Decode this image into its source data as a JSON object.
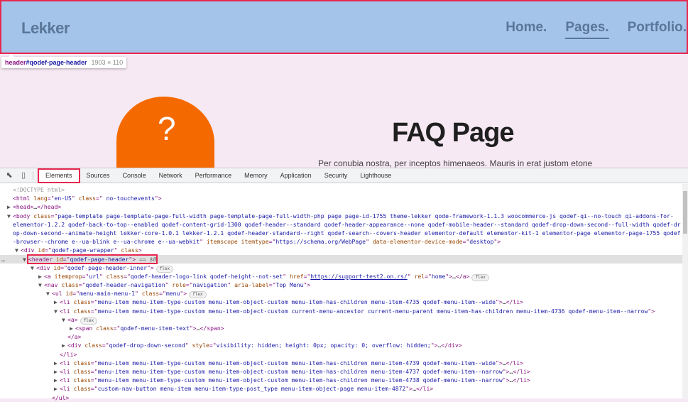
{
  "site": {
    "logo": "Lekker",
    "nav": [
      {
        "label": "Home.",
        "active": false
      },
      {
        "label": "Pages.",
        "active": true
      },
      {
        "label": "Portfolio.",
        "active": false
      }
    ],
    "faq_icon": "?",
    "title": "FAQ Page",
    "subtitle": "Per conubia nostra, per inceptos himenaeos. Mauris in erat justom etone"
  },
  "tooltip": {
    "tag": "header",
    "id": "#qodef-page-header",
    "size": "1903 × 110"
  },
  "devtools": {
    "icons": [
      "inspect-element-icon",
      "device-toggle-icon"
    ],
    "tabs": [
      "Elements",
      "Sources",
      "Console",
      "Network",
      "Performance",
      "Memory",
      "Application",
      "Security",
      "Lighthouse"
    ],
    "selected_tab": "Elements",
    "lines": [
      {
        "i": 0,
        "a": "",
        "t": [
          [
            "cm",
            "<!DOCTYPE html>"
          ]
        ]
      },
      {
        "i": 0,
        "a": "",
        "t": [
          [
            "tag",
            "<html "
          ],
          [
            "an",
            "lang"
          ],
          [
            "tag",
            "=\""
          ],
          [
            "av",
            "en-US"
          ],
          [
            "tag",
            "\" "
          ],
          [
            "an",
            "class"
          ],
          [
            "tag",
            "=\""
          ],
          [
            "av",
            " no-touchevents"
          ],
          [
            "tag",
            "\">"
          ]
        ]
      },
      {
        "i": 0,
        "a": "▶",
        "t": [
          [
            "tag",
            "<head>"
          ],
          [
            "tx",
            "…"
          ],
          [
            "tag",
            "</head>"
          ]
        ]
      },
      {
        "i": 0,
        "a": "▼",
        "t": [
          [
            "tag",
            "<body "
          ],
          [
            "an",
            "class"
          ],
          [
            "tag",
            "=\""
          ],
          [
            "av",
            "page-template page-template-page-full-width page-template-page-full-width-php page page-id-1755 theme-lekker qode-framework-1.1.3 woocommerce-js qodef-qi--no-touch qi-addons-for-"
          ]
        ]
      },
      {
        "i": 0,
        "a": "",
        "t": [
          [
            "av",
            "elementor-1.2.2 qodef-back-to-top--enabled qodef-content-grid-1300 qodef-header--standard qodef-header-appearance--none qodef-mobile-header--standard qodef-drop-down-second--full-width qodef-dr"
          ]
        ]
      },
      {
        "i": 0,
        "a": "",
        "t": [
          [
            "av",
            "op-down-second--animate-height lekker-core-1.0.1 lekker-1.2.1 qodef-header-standard--right qodef-search--covers-header elementor-default elementor-kit-1 elementor-page elementor-page-1755 qodef"
          ]
        ]
      },
      {
        "i": 0,
        "a": "",
        "t": [
          [
            "av",
            "-browser--chrome e--ua-blink e--ua-chrome e--ua-webkit"
          ],
          [
            "tag",
            "\" "
          ],
          [
            "an",
            "itemscope itemtype"
          ],
          [
            "tag",
            "=\""
          ],
          [
            "av",
            "https://schema.org/WebPage"
          ],
          [
            "tag",
            "\" "
          ],
          [
            "an",
            "data-elementor-device-mode"
          ],
          [
            "tag",
            "=\""
          ],
          [
            "av",
            "desktop"
          ],
          [
            "tag",
            "\">"
          ]
        ]
      },
      {
        "i": 1,
        "a": "▼",
        "t": [
          [
            "tag",
            "<div "
          ],
          [
            "an",
            "id"
          ],
          [
            "tag",
            "=\""
          ],
          [
            "av",
            "qodef-page-wrapper"
          ],
          [
            "tag",
            "\" "
          ],
          [
            "an",
            "class"
          ],
          [
            "tag",
            ">"
          ]
        ]
      },
      {
        "i": 2,
        "a": "▼",
        "sel": true,
        "t": [
          [
            "tag",
            "<header "
          ],
          [
            "an",
            "id"
          ],
          [
            "tag",
            "=\""
          ],
          [
            "av",
            "qodef-page-header"
          ],
          [
            "tag",
            "\">"
          ],
          [
            "sv",
            " == $0"
          ]
        ]
      },
      {
        "i": 3,
        "a": "▼",
        "t": [
          [
            "tag",
            "<div "
          ],
          [
            "an",
            "id"
          ],
          [
            "tag",
            "=\""
          ],
          [
            "av",
            "qodef-page-header-inner"
          ],
          [
            "tag",
            "\">"
          ]
        ],
        "badge": "flex"
      },
      {
        "i": 4,
        "a": "▶",
        "t": [
          [
            "tag",
            "<a "
          ],
          [
            "an",
            "itemprop"
          ],
          [
            "tag",
            "=\""
          ],
          [
            "av",
            "url"
          ],
          [
            "tag",
            "\" "
          ],
          [
            "an",
            "class"
          ],
          [
            "tag",
            "=\""
          ],
          [
            "av",
            "qodef-header-logo-link qodef-height--not-set"
          ],
          [
            "tag",
            "\" "
          ],
          [
            "an",
            "href"
          ],
          [
            "tag",
            "=\""
          ],
          [
            "lk",
            "https://support-test2.on.rs/"
          ],
          [
            "tag",
            "\" "
          ],
          [
            "an",
            "rel"
          ],
          [
            "tag",
            "=\""
          ],
          [
            "av",
            "home"
          ],
          [
            "tag",
            "\">"
          ],
          [
            "tx",
            "…"
          ],
          [
            "tag",
            "</a>"
          ]
        ],
        "badge": "flex"
      },
      {
        "i": 4,
        "a": "▼",
        "t": [
          [
            "tag",
            "<nav "
          ],
          [
            "an",
            "class"
          ],
          [
            "tag",
            "=\""
          ],
          [
            "av",
            "qodef-header-navigation"
          ],
          [
            "tag",
            "\" "
          ],
          [
            "an",
            "role"
          ],
          [
            "tag",
            "=\""
          ],
          [
            "av",
            "navigation"
          ],
          [
            "tag",
            "\" "
          ],
          [
            "an",
            "aria-label"
          ],
          [
            "tag",
            "=\""
          ],
          [
            "av",
            "Top Menu"
          ],
          [
            "tag",
            "\">"
          ]
        ]
      },
      {
        "i": 5,
        "a": "▼",
        "t": [
          [
            "tag",
            "<ul "
          ],
          [
            "an",
            "id"
          ],
          [
            "tag",
            "=\""
          ],
          [
            "av",
            "menu-main-menu-1"
          ],
          [
            "tag",
            "\" "
          ],
          [
            "an",
            "class"
          ],
          [
            "tag",
            "=\""
          ],
          [
            "av",
            "menu"
          ],
          [
            "tag",
            "\">"
          ]
        ],
        "badge": "flex"
      },
      {
        "i": 6,
        "a": "▶",
        "t": [
          [
            "tag",
            "<li "
          ],
          [
            "an",
            "class"
          ],
          [
            "tag",
            "=\""
          ],
          [
            "av",
            "menu-item menu-item-type-custom menu-item-object-custom menu-item-has-children menu-item-4735 qodef-menu-item--wide"
          ],
          [
            "tag",
            "\">"
          ],
          [
            "tx",
            "…"
          ],
          [
            "tag",
            "</li>"
          ]
        ]
      },
      {
        "i": 6,
        "a": "▼",
        "t": [
          [
            "tag",
            "<li "
          ],
          [
            "an",
            "class"
          ],
          [
            "tag",
            "=\""
          ],
          [
            "av",
            "menu-item menu-item-type-custom menu-item-object-custom current-menu-ancestor current-menu-parent menu-item-has-children menu-item-4736 qodef-menu-item--narrow"
          ],
          [
            "tag",
            "\">"
          ]
        ]
      },
      {
        "i": 7,
        "a": "▼",
        "t": [
          [
            "tag",
            "<a>"
          ]
        ],
        "badge": "flex"
      },
      {
        "i": 8,
        "a": "▶",
        "t": [
          [
            "tag",
            "<span "
          ],
          [
            "an",
            "class"
          ],
          [
            "tag",
            "=\""
          ],
          [
            "av",
            "qodef-menu-item-text"
          ],
          [
            "tag",
            "\">"
          ],
          [
            "tx",
            "…"
          ],
          [
            "tag",
            "</span>"
          ]
        ]
      },
      {
        "i": 7,
        "a": "",
        "t": [
          [
            "tag",
            "</a>"
          ]
        ]
      },
      {
        "i": 7,
        "a": "▶",
        "t": [
          [
            "tag",
            "<div "
          ],
          [
            "an",
            "class"
          ],
          [
            "tag",
            "=\""
          ],
          [
            "av",
            "qodef-drop-down-second"
          ],
          [
            "tag",
            "\" "
          ],
          [
            "an",
            "style"
          ],
          [
            "tag",
            "=\""
          ],
          [
            "av",
            "visibility: hidden; height: 0px; opacity: 0; overflow: hidden;"
          ],
          [
            "tag",
            "\">"
          ],
          [
            "tx",
            "…"
          ],
          [
            "tag",
            "</div>"
          ]
        ]
      },
      {
        "i": 6,
        "a": "",
        "t": [
          [
            "tag",
            "</li>"
          ]
        ]
      },
      {
        "i": 6,
        "a": "▶",
        "t": [
          [
            "tag",
            "<li "
          ],
          [
            "an",
            "class"
          ],
          [
            "tag",
            "=\""
          ],
          [
            "av",
            "menu-item menu-item-type-custom menu-item-object-custom menu-item-has-children menu-item-4739 qodef-menu-item--wide"
          ],
          [
            "tag",
            "\">"
          ],
          [
            "tx",
            "…"
          ],
          [
            "tag",
            "</li>"
          ]
        ]
      },
      {
        "i": 6,
        "a": "▶",
        "t": [
          [
            "tag",
            "<li "
          ],
          [
            "an",
            "class"
          ],
          [
            "tag",
            "=\""
          ],
          [
            "av",
            "menu-item menu-item-type-custom menu-item-object-custom menu-item-has-children menu-item-4737 qodef-menu-item--narrow"
          ],
          [
            "tag",
            "\">"
          ],
          [
            "tx",
            "…"
          ],
          [
            "tag",
            "</li>"
          ]
        ]
      },
      {
        "i": 6,
        "a": "▶",
        "t": [
          [
            "tag",
            "<li "
          ],
          [
            "an",
            "class"
          ],
          [
            "tag",
            "=\""
          ],
          [
            "av",
            "menu-item menu-item-type-custom menu-item-object-custom menu-item-has-children menu-item-4738 qodef-menu-item--narrow"
          ],
          [
            "tag",
            "\">"
          ],
          [
            "tx",
            "…"
          ],
          [
            "tag",
            "</li>"
          ]
        ]
      },
      {
        "i": 6,
        "a": "▶",
        "t": [
          [
            "tag",
            "<li "
          ],
          [
            "an",
            "class"
          ],
          [
            "tag",
            "=\""
          ],
          [
            "av",
            "custom-nav-button menu-item menu-item-type-post_type menu-item-object-page menu-item-4872"
          ],
          [
            "tag",
            "\">"
          ],
          [
            "tx",
            "…"
          ],
          [
            "tag",
            "</li>"
          ]
        ]
      },
      {
        "i": 5,
        "a": "",
        "t": [
          [
            "tag",
            "</ul>"
          ]
        ]
      }
    ],
    "dots": "…"
  },
  "colors": {
    "highlight": "#e8264f",
    "header_bg": "#a4c5e9",
    "page_bg": "#f6e9f3",
    "blob": "#f46a00"
  }
}
